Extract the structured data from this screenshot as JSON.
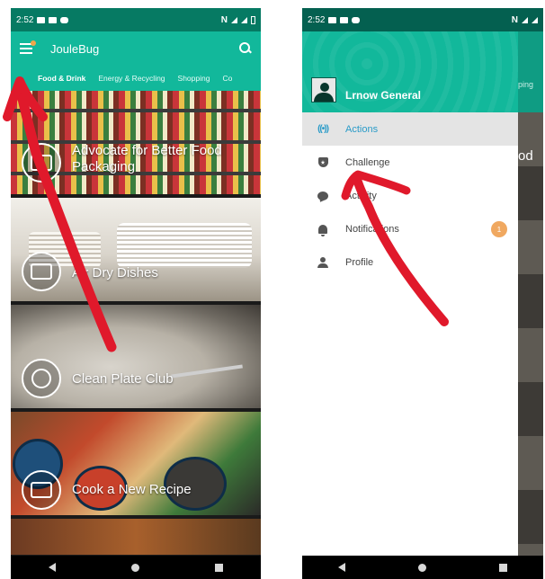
{
  "left_phone": {
    "status_time": "2:52",
    "status_right": "N",
    "app_title": "JouleBug",
    "tabs": [
      "Food & Drink",
      "Energy & Recycling",
      "Shopping",
      "Co"
    ],
    "active_tab": "Food & Drink",
    "cards": [
      {
        "title_line1": "Advocate for Better Food",
        "title_line2": "Packaging",
        "icon": "packaging-icon"
      },
      {
        "title_line1": "Air Dry Dishes",
        "title_line2": "",
        "icon": "dishwasher-icon"
      },
      {
        "title_line1": "Clean Plate Club",
        "title_line2": "",
        "icon": "plate-icon"
      },
      {
        "title_line1": "Cook a New Recipe",
        "title_line2": "",
        "icon": "chef-hat-icon"
      }
    ]
  },
  "right_phone": {
    "status_time": "2:52",
    "status_right": "N",
    "user_name": "Lrnow General",
    "peek_tab": "ping",
    "peek_text": "od",
    "menu": [
      {
        "label": "Actions",
        "icon": "actions-icon",
        "active": true
      },
      {
        "label": "Challenge",
        "icon": "challenge-shield-icon"
      },
      {
        "label": "Activity",
        "icon": "chat-bubble-icon"
      },
      {
        "label": "Notifications",
        "icon": "bell-icon",
        "badge": "1"
      },
      {
        "label": "Profile",
        "icon": "person-icon"
      }
    ]
  },
  "colors": {
    "brand_teal": "#12b89b",
    "status_teal": "#067a63",
    "active_blue": "#2a9bc8",
    "badge_orange": "#f0a860",
    "annotation_red": "#e0192b"
  }
}
